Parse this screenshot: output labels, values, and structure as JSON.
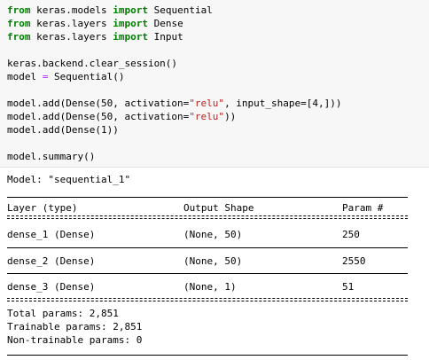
{
  "code_cell": {
    "lines": [
      {
        "kw1": "from",
        "t1": " keras.models ",
        "kw2": "import",
        "t2": " Sequential"
      },
      {
        "kw1": "from",
        "t1": " keras.layers ",
        "kw2": "import",
        "t2": " Dense"
      },
      {
        "kw1": "from",
        "t1": " keras.layers ",
        "kw2": "import",
        "t2": " Input"
      }
    ],
    "clear_session": "keras.backend.clear_session()",
    "model_assign": {
      "lhs": "model ",
      "op": "=",
      "rhs": " Sequential()"
    },
    "add1": {
      "pre": "model.add(Dense(50, activation=",
      "str": "\"relu\"",
      "mid": ", input_shape=[4,]))"
    },
    "add2": {
      "pre": "model.add(Dense(50, activation=",
      "str": "\"relu\"",
      "post": "))"
    },
    "add3": "model.add(Dense(1))",
    "summary_call": "model.summary()"
  },
  "output": {
    "model_name": "Model: \"sequential_1\"",
    "headers": {
      "layer": "Layer (type)",
      "shape": "Output Shape",
      "params": "Param #"
    },
    "rows": [
      {
        "layer": "dense_1 (Dense)",
        "shape": "(None, 50)",
        "params": "250"
      },
      {
        "layer": "dense_2 (Dense)",
        "shape": "(None, 50)",
        "params": "2550"
      },
      {
        "layer": "dense_3 (Dense)",
        "shape": "(None, 1)",
        "params": "51"
      }
    ],
    "total": "Total params: 2,851",
    "trainable": "Trainable params: 2,851",
    "non_trainable": "Non-trainable params: 0"
  },
  "colors": {
    "keyword": "#008000",
    "string": "#ba2121",
    "operator": "#aa22ff",
    "cell_background": "#f7f7f7"
  }
}
